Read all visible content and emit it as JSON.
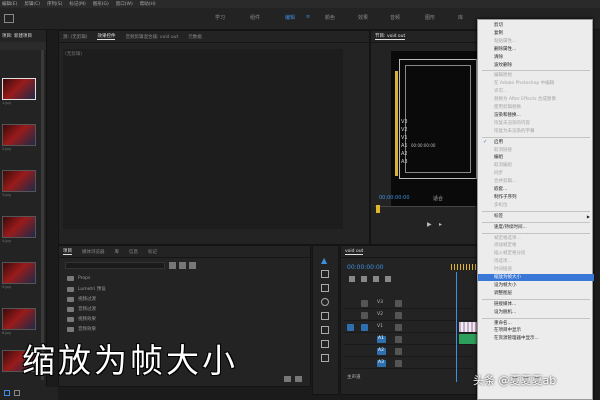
{
  "menubar": {
    "items": [
      "编辑(E)",
      "剪辑(C)",
      "序列(S)",
      "标记(M)",
      "图形(G)",
      "窗口(W)",
      "帮助(H)"
    ]
  },
  "workspaces": [
    "学习",
    "组件",
    "编辑",
    "颜色",
    "效果",
    "音频",
    "图形",
    "库"
  ],
  "active_workspace": "编辑",
  "left_panel": {
    "header": "项目: 新建项目",
    "thumbnails": [
      "1.jpg",
      "2.jpg",
      "3.jpg",
      "4.jpg",
      "5.jpg",
      "6.jpg",
      "7.jpg"
    ]
  },
  "source_panel": {
    "tabs": [
      "源: (无剪辑)",
      "效果控件",
      "音频剪辑混合器: void out",
      "元数据"
    ],
    "empty_text": "(无剪辑)"
  },
  "program_monitor": {
    "tab": "节目: void out",
    "tracks": [
      "V3",
      "V2",
      "V1",
      "A1",
      "A2",
      "A3"
    ],
    "timecode": "00:00:00:00",
    "overlay_timecode": "00:00:00:00",
    "fit": "适合"
  },
  "project_panel": {
    "tabs": [
      "项目",
      "媒体浏览器",
      "库",
      "信息",
      "标记"
    ],
    "bins": [
      "Props",
      "Lumetri 预设",
      "视频过渡",
      "音频过渡",
      "视频效果",
      "音频效果"
    ]
  },
  "timeline": {
    "tab": "void out",
    "timecode": "00:00:00:00",
    "tracks": [
      "V3",
      "V2",
      "V1",
      "A1",
      "A2",
      "A3"
    ],
    "master": "主声道"
  },
  "context_menu": {
    "items": [
      {
        "label": "剪切",
        "enabled": true
      },
      {
        "label": "复制",
        "enabled": true
      },
      {
        "label": "粘贴属性...",
        "enabled": false
      },
      {
        "label": "删除属性...",
        "enabled": true
      },
      {
        "label": "清除",
        "enabled": true
      },
      {
        "label": "波纹删除",
        "enabled": true
      },
      {
        "sep": true
      },
      {
        "label": "编辑原始",
        "enabled": false
      },
      {
        "label": "在 Adobe Photoshop 中编辑",
        "enabled": false
      },
      {
        "label": "许可...",
        "enabled": false
      },
      {
        "label": "替换为 After Effects 合成图像",
        "enabled": false
      },
      {
        "label": "使用剪辑替换",
        "enabled": false
      },
      {
        "label": "渲染和替换...",
        "enabled": true
      },
      {
        "label": "恢复未渲染的内容",
        "enabled": false
      },
      {
        "label": "恢复为未渲染的字幕",
        "enabled": false
      },
      {
        "sep": true
      },
      {
        "label": "启用",
        "enabled": true,
        "checked": true
      },
      {
        "label": "取消链接",
        "enabled": false
      },
      {
        "label": "编组",
        "enabled": true
      },
      {
        "label": "取消编组",
        "enabled": false
      },
      {
        "label": "同步",
        "enabled": false
      },
      {
        "label": "合并剪辑...",
        "enabled": false
      },
      {
        "label": "嵌套...",
        "enabled": true
      },
      {
        "label": "制作子序列",
        "enabled": true
      },
      {
        "label": "多机位",
        "enabled": false
      },
      {
        "sep": true
      },
      {
        "label": "标签",
        "enabled": true,
        "submenu": true
      },
      {
        "sep": true
      },
      {
        "label": "速度/持续时间...",
        "enabled": true
      },
      {
        "sep": true
      },
      {
        "label": "帧定格选项...",
        "enabled": false
      },
      {
        "label": "添加帧定格",
        "enabled": false
      },
      {
        "label": "插入帧定格分段",
        "enabled": false
      },
      {
        "label": "场选项...",
        "enabled": false
      },
      {
        "label": "时间插值",
        "enabled": false
      },
      {
        "label": "缩放为帧大小",
        "enabled": true,
        "highlight": true
      },
      {
        "label": "设为帧大小",
        "enabled": true
      },
      {
        "label": "调整图层",
        "enabled": true
      },
      {
        "sep": true
      },
      {
        "label": "链接媒体...",
        "enabled": true
      },
      {
        "label": "设为脱机...",
        "enabled": true
      },
      {
        "sep": true
      },
      {
        "label": "重命名...",
        "enabled": true
      },
      {
        "label": "在项目中显示",
        "enabled": true
      },
      {
        "label": "在资源管理器中显示...",
        "enabled": true
      }
    ]
  },
  "caption": "缩放为帧大小",
  "watermark": "头条 @夏夏夏ab",
  "colors": {
    "accent": "#3f8fe0",
    "highlight": "#3a78d8",
    "playhead": "#e1b52a",
    "panel": "#232323"
  }
}
